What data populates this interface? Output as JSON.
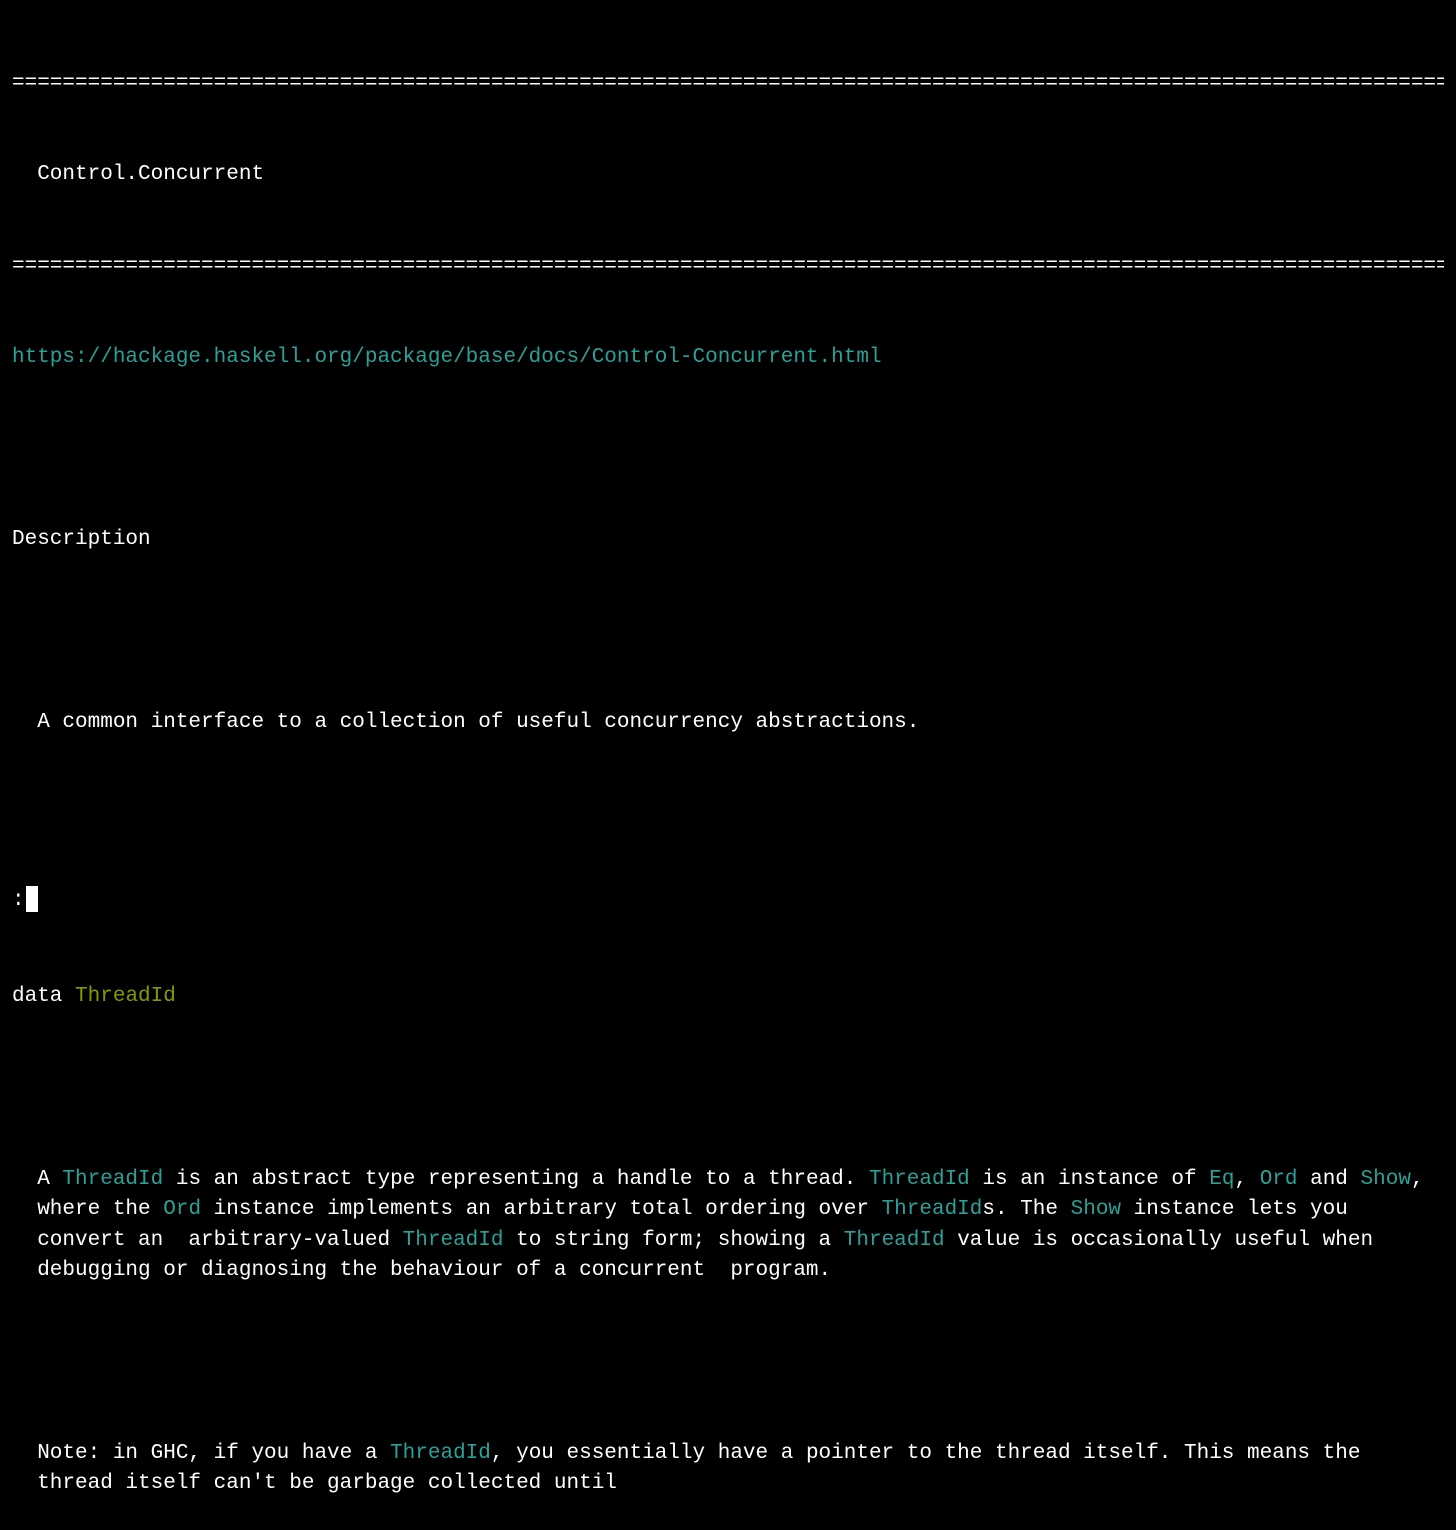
{
  "divider": "====================================================================================================================",
  "module_title": "Control.Concurrent",
  "url": "https://hackage.haskell.org/package/base/docs/Control-Concurrent.html",
  "description_label": "Description",
  "description_body": "A common interface to a collection of useful concurrency abstractions.",
  "data_decl": {
    "keyword": "data",
    "name": "ThreadId"
  },
  "threadid_doc": {
    "p1_parts": {
      "t1": "A ",
      "r1": "ThreadId",
      "t2": " is an abstract type representing a handle to a thread. ",
      "r2": "ThreadId",
      "t3": " is an instance of ",
      "r3": "Eq",
      "t4": ", ",
      "r4": "Ord",
      "t5": " and ",
      "r5": "Show",
      "t6": ", where the ",
      "r6": "Ord",
      "t7": " instance implements an arbitrary total ordering over ",
      "r7": "ThreadId",
      "t8": "s. The ",
      "r8": "Show",
      "t9": " instance lets you convert an  arbitrary-valued ",
      "r9": "ThreadId",
      "t10": " to string form; showing a ",
      "r10": "ThreadId",
      "t11": " value is occasionally useful when debugging or diagnosing the behaviour of a concurrent  program."
    },
    "p2_parts": {
      "t1": "Note: in GHC, if you have a ",
      "r1": "ThreadId",
      "t2": ", you essentially have a pointer to the thread itself. This means the thread itself can't be garbage collected until"
    }
  },
  "prompt": ":"
}
